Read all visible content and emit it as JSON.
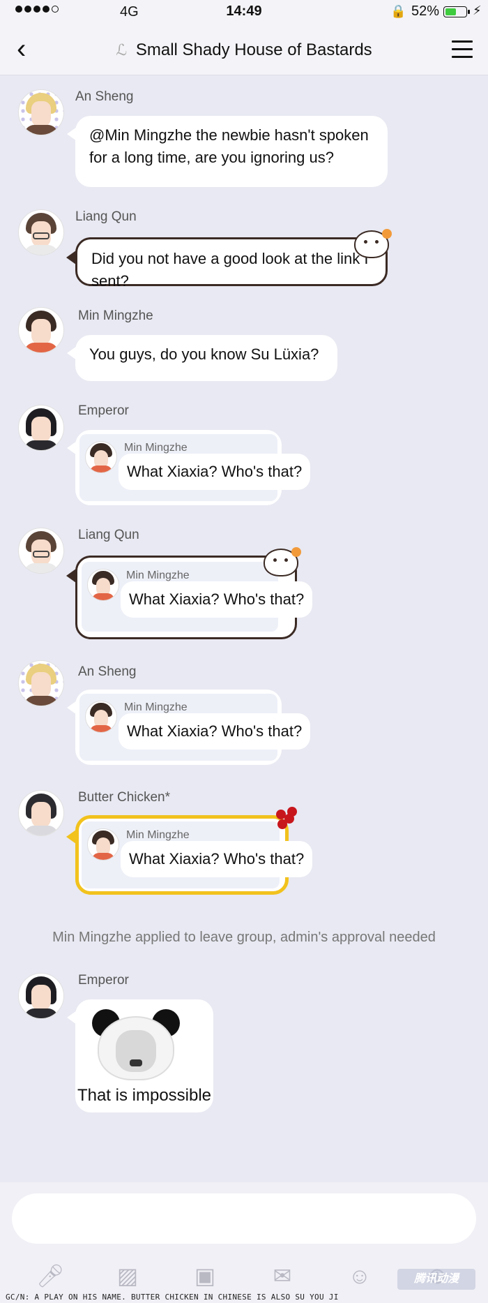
{
  "status_bar": {
    "network": "4G",
    "time": "14:49",
    "battery_percent": "52%",
    "battery_level": 0.52
  },
  "header": {
    "title": "Small Shady House of Bastards",
    "back_icon": "chevron-left-icon",
    "menu_icon": "hamburger-menu-icon"
  },
  "messages": [
    {
      "sender": "An Sheng",
      "text": "@Min Mingzhe the newbie hasn't spoken for a long time, are you ignoring us?"
    },
    {
      "sender": "Liang Qun",
      "text": "Did you not have a good look at the link I sent?"
    },
    {
      "sender": "Min Mingzhe",
      "text": "You guys, do you know Su Lüxia?"
    },
    {
      "sender": "Emperor",
      "quote_name": "Min Mingzhe",
      "quote_text": "What Xiaxia? Who's that?"
    },
    {
      "sender": "Liang Qun",
      "quote_name": "Min Mingzhe",
      "quote_text": "What Xiaxia? Who's that?"
    },
    {
      "sender": "An Sheng",
      "quote_name": "Min Mingzhe",
      "quote_text": "What Xiaxia? Who's that?"
    },
    {
      "sender": "Butter Chicken*",
      "quote_name": "Min Mingzhe",
      "quote_text": "What Xiaxia? Who's that?"
    },
    {
      "sender": "Emperor",
      "sticker_caption": "That is impossible"
    }
  ],
  "system_notice": "Min Mingzhe applied to leave group, admin's approval needed",
  "input": {
    "placeholder": ""
  },
  "toolbar": {
    "icons": [
      "microphone-icon",
      "image-icon",
      "camera-icon",
      "red-packet-icon",
      "emoji-icon",
      "plus-icon"
    ]
  },
  "watermark": "腾讯动漫",
  "footnote": "GC/N: A PLAY ON HIS NAME. BUTTER CHICKEN IN CHINESE IS ALSO SU YOU JI",
  "colors": {
    "background": "#e8e9f2",
    "bubble": "#ffffff",
    "yellow_border": "#f2c21d",
    "outline_border": "#3b2a24"
  }
}
